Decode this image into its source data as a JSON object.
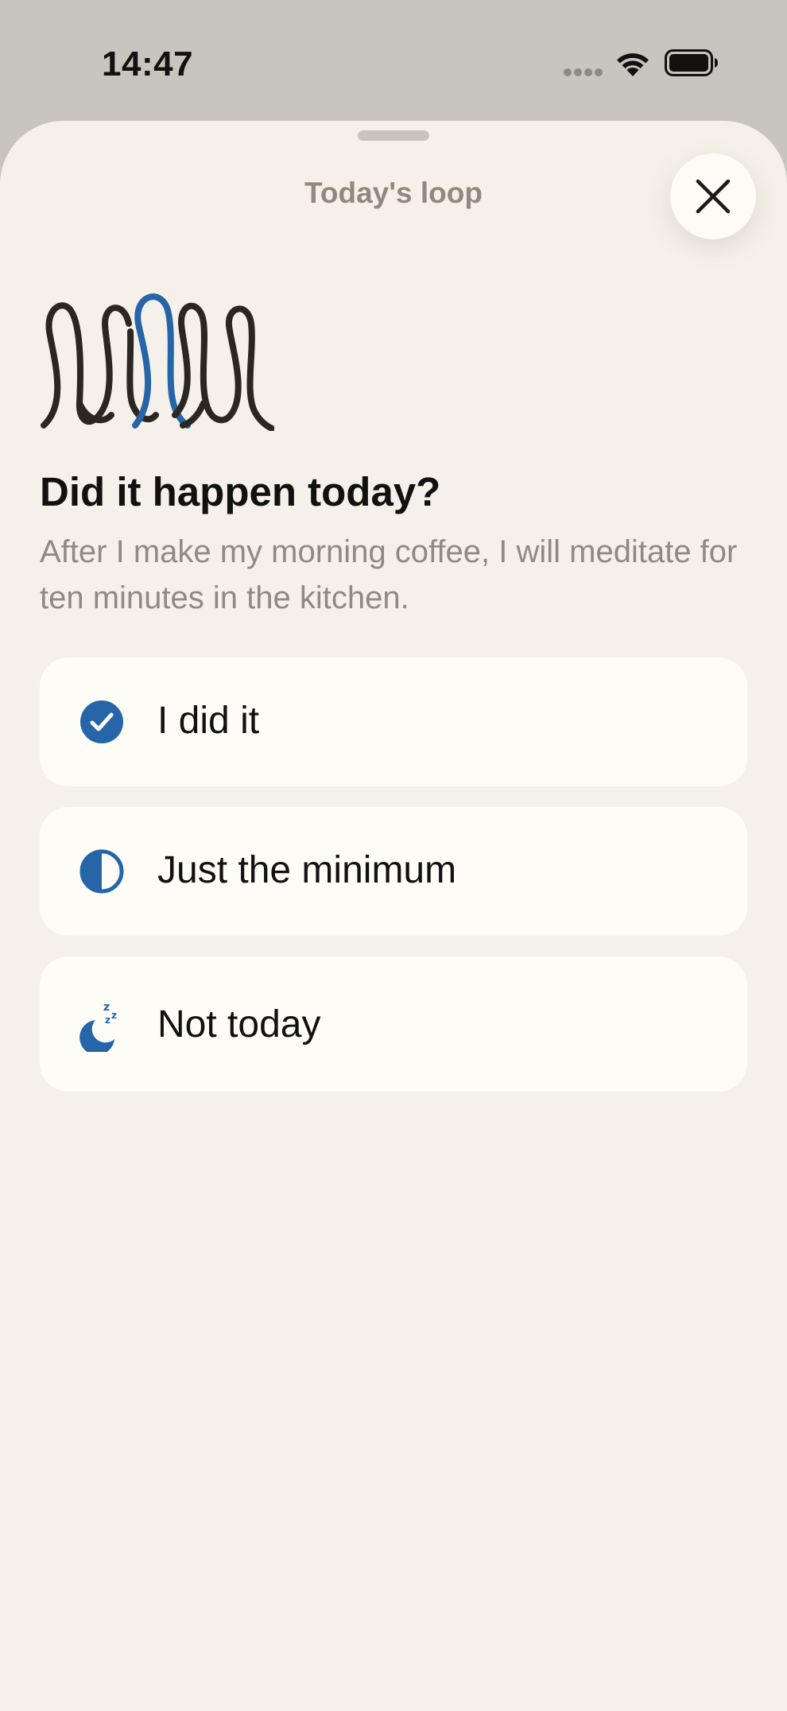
{
  "status_bar": {
    "time": "14:47",
    "signal_icon": "signal-dots-icon",
    "wifi_icon": "wifi-icon",
    "battery_icon": "battery-icon"
  },
  "sheet": {
    "title": "Today's loop",
    "close_icon": "close-icon"
  },
  "main": {
    "illustration": "loop-illustration",
    "question": "Did it happen today?",
    "habit_text": "After I make my morning coffee, I will meditate for ten minutes in the kitchen."
  },
  "options": [
    {
      "label": "I did it",
      "icon": "check-circle-icon"
    },
    {
      "label": "Just the minimum",
      "icon": "half-circle-icon"
    },
    {
      "label": "Not today",
      "icon": "moon-sleep-icon"
    }
  ],
  "colors": {
    "accent": "#2565a8",
    "ink": "#2a2620",
    "sheet_background": "#f5f1ea",
    "card_background": "#fdfcf7",
    "muted_text": "#8e8a84"
  }
}
